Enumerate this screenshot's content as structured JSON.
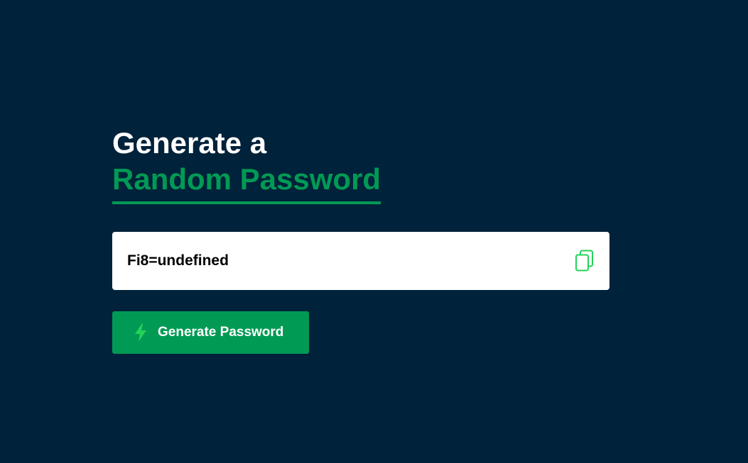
{
  "heading": {
    "line1": "Generate a",
    "line2": "Random Password"
  },
  "password": {
    "value": "Fi8=undefined"
  },
  "icons": {
    "copy": "copy-icon",
    "generate": "lightning-bolt-icon"
  },
  "generate_button": {
    "label": "Generate Password"
  },
  "colors": {
    "background": "#00223a",
    "accent": "#019a54",
    "icon_accent": "#22d35a",
    "box": "#ffffff",
    "text_dark": "#000000",
    "text_light": "#ffffff"
  }
}
